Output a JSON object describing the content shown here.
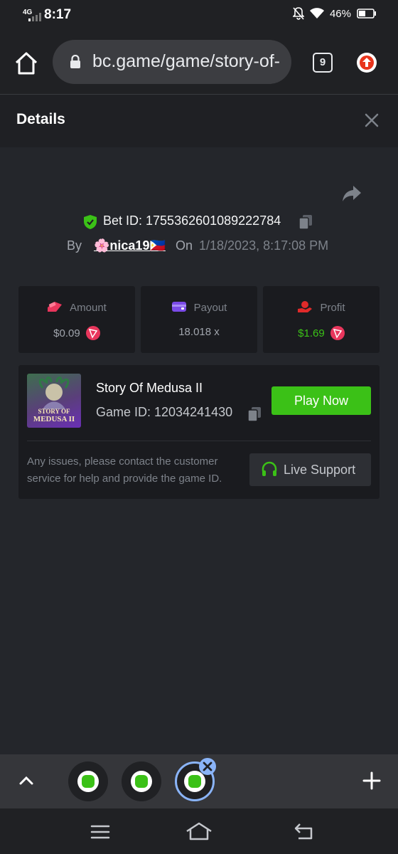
{
  "status_bar": {
    "network": "4G",
    "time": "8:17",
    "battery": "46%"
  },
  "browser": {
    "url": "bc.game/game/story-of-",
    "tab_count": "9"
  },
  "details": {
    "title": "Details"
  },
  "bet": {
    "bet_id_label": "Bet ID: 1755362601089222784",
    "by_label": "By",
    "username": "🌸nica19🇵🇭",
    "on_label": "On",
    "date": "1/18/2023, 8:17:08 PM"
  },
  "stats": [
    {
      "label": "Amount",
      "value": "$0.09",
      "icon": "amount-icon",
      "color": "#e8365c"
    },
    {
      "label": "Payout",
      "value": "18.018 x",
      "icon": "wallet-icon",
      "color": "#7b4be8"
    },
    {
      "label": "Profit",
      "value": "$1.69",
      "icon": "profit-icon",
      "color": "#e02a2a"
    }
  ],
  "game": {
    "thumb_line1": "STORY OF",
    "thumb_line2": "MEDUSA II",
    "name": "Story Of Medusa II",
    "game_id": "Game ID: 12034241430",
    "play_label": "Play Now",
    "issues_text": "Any issues, please contact the customer service for help and provide the game ID.",
    "support_label": "Live Support"
  },
  "colors": {
    "accent_green": "#3bc117",
    "background": "#24262b",
    "card": "#1a1b1f"
  }
}
